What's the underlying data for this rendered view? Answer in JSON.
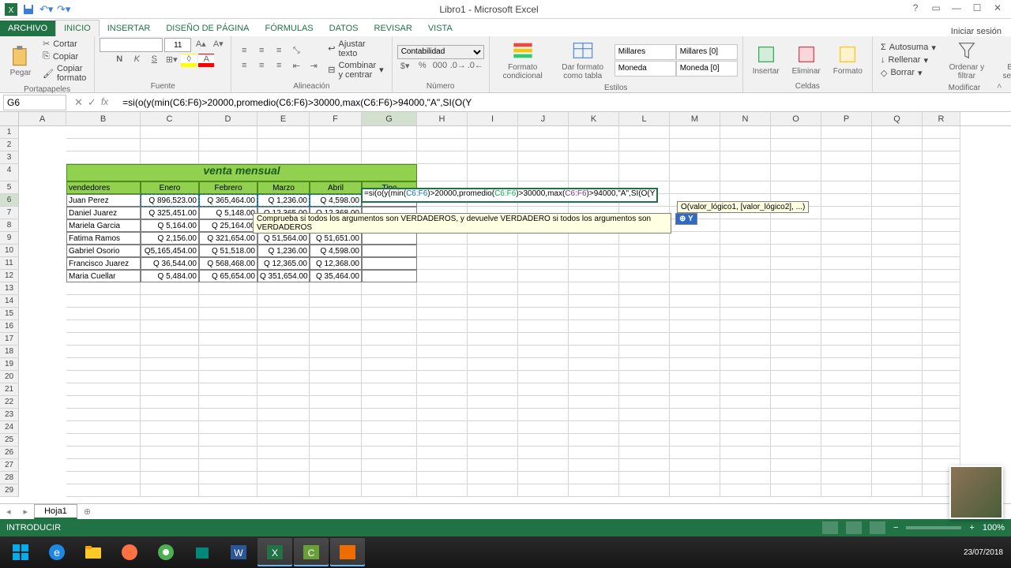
{
  "window": {
    "title": "Libro1 - Microsoft Excel",
    "signin": "Iniciar sesión"
  },
  "tabs": {
    "file": "ARCHIVO",
    "home": "INICIO",
    "insert": "INSERTAR",
    "layout": "DISEÑO DE PÁGINA",
    "formulas": "FÓRMULAS",
    "data": "DATOS",
    "review": "REVISAR",
    "view": "VISTA"
  },
  "ribbon": {
    "clipboard": {
      "label": "Portapapeles",
      "paste": "Pegar",
      "cut": "Cortar",
      "copy": "Copiar",
      "format": "Copiar formato"
    },
    "font": {
      "label": "Fuente",
      "size": "11",
      "bold": "N",
      "italic": "K",
      "underline": "S"
    },
    "align": {
      "label": "Alineación",
      "wrap": "Ajustar texto",
      "merge": "Combinar y centrar"
    },
    "number": {
      "label": "Número",
      "format": "Contabilidad"
    },
    "styles": {
      "label": "Estilos",
      "cond": "Formato condicional",
      "table": "Dar formato como tabla",
      "millares": "Millares",
      "millares0": "Millares [0]",
      "moneda": "Moneda",
      "moneda0": "Moneda [0]"
    },
    "cells": {
      "label": "Celdas",
      "insert": "Insertar",
      "delete": "Eliminar",
      "format": "Formato"
    },
    "editing": {
      "label": "Modificar",
      "sum": "Autosuma",
      "fill": "Rellenar",
      "clear": "Borrar",
      "sort": "Ordenar y filtrar",
      "find": "Buscar y seleccionar"
    }
  },
  "fbar": {
    "ref": "G6",
    "formula": "=si(o(y(min(C6:F6)>20000,promedio(C6:F6)>30000,max(C6:F6)>94000,\"A\",SI(O(Y"
  },
  "cols": [
    "A",
    "B",
    "C",
    "D",
    "E",
    "F",
    "G",
    "H",
    "I",
    "J",
    "K",
    "L",
    "M",
    "N",
    "O",
    "P",
    "Q",
    "R"
  ],
  "table": {
    "title": "venta mensual",
    "heads": {
      "vend": "vendedores",
      "enero": "Enero",
      "feb": "Febrero",
      "mar": "Marzo",
      "abr": "Abril",
      "tipo": "Tipo"
    },
    "rows": [
      {
        "name": "Juan Perez",
        "c": "Q    896,523.00",
        "d": "Q 365,464.00",
        "e": "Q     1,236.00",
        "f": "Q   4,598.00"
      },
      {
        "name": "Daniel Juarez",
        "c": "Q    325,451.00",
        "d": "Q     5,148.00",
        "e": "Q   12,365.00",
        "f": "Q 12,368.00"
      },
      {
        "name": "Mariela Garcia",
        "c": "Q        5,164.00",
        "d": "Q   25,164.00",
        "e": "",
        "f": ""
      },
      {
        "name": "Fatima Ramos",
        "c": "Q        2,156.00",
        "d": "Q 321,654.00",
        "e": "Q   51,564.00",
        "f": "Q 51,651.00"
      },
      {
        "name": "Gabriel Osorio",
        "c": "Q5,165,454.00",
        "d": "Q   51,518.00",
        "e": "Q     1,236.00",
        "f": "Q   4,598.00"
      },
      {
        "name": "Francisco Juarez",
        "c": "Q      36,544.00",
        "d": "Q 568,468.00",
        "e": "Q   12,365.00",
        "f": "Q 12,368.00"
      },
      {
        "name": "Maria Cuellar",
        "c": "Q        5,484.00",
        "d": "Q   65,654.00",
        "e": "Q 351,654.00",
        "f": "Q 35,464.00"
      }
    ]
  },
  "editcell": {
    "pre": "=si(o(y(min(",
    "r1": "C6:F6",
    "m1": ")>20000,promedio(",
    "r2": "C6:F6",
    "m2": ")>30000,max(",
    "r3": "C6:F6",
    "m3": ")>94000,\"A\",SI(O(Y"
  },
  "tooltip": {
    "o": "O(valor_lógico1, [valor_lógico2], ...)",
    "y": "Y",
    "desc": "Comprueba si todos los argumentos son VERDADEROS, y devuelve VERDADERO si todos los argumentos son VERDADEROS"
  },
  "sheet": {
    "name": "Hoja1"
  },
  "status": {
    "mode": "INTRODUCIR",
    "zoom": "100%"
  },
  "tray": {
    "time": "",
    "date": "23/07/2018"
  }
}
